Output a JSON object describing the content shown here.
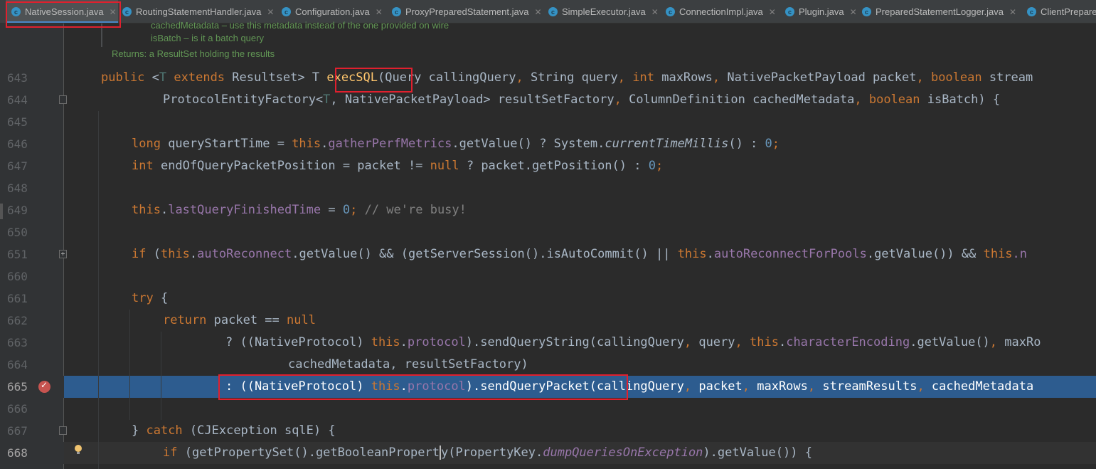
{
  "tabs": [
    {
      "label": "NativeSession.java",
      "active": true
    },
    {
      "label": "RoutingStatementHandler.java"
    },
    {
      "label": "Configuration.java"
    },
    {
      "label": "ProxyPreparedStatement.java"
    },
    {
      "label": "SimpleExecutor.java"
    },
    {
      "label": "ConnectionImpl.java"
    },
    {
      "label": "Plugin.java"
    },
    {
      "label": "PreparedStatementLogger.java"
    },
    {
      "label": "ClientPrepare"
    }
  ],
  "doc_comment": {
    "line1": "cachedMetadata – use this metadata instead of the one provided on wire",
    "line2": "isBatch – is it a batch query",
    "returns": "Returns: a ResultSet holding the results"
  },
  "line_numbers": [
    "643",
    "644",
    "645",
    "646",
    "647",
    "648",
    "649",
    "650",
    "651",
    "660",
    "661",
    "662",
    "663",
    "664",
    "665",
    "666",
    "667",
    "668"
  ],
  "code": {
    "l643": {
      "kw_public": "public",
      "lt": " <",
      "tparam": "T",
      "kw_extends": " extends",
      "rs": " Resultset> T ",
      "method": "execSQL",
      "args1": "(Query callingQuery",
      "c1": ",",
      "args2": " String query",
      "c2": ",",
      "kw_int": " int",
      "args3": " maxRows",
      "c3": ",",
      "args4": " NativePacketPayload packet",
      "c4": ",",
      "kw_bool": " boolean",
      "args5": " stream"
    },
    "l644": {
      "a": "ProtocolEntityFactory<",
      "tp": "T",
      "b": ", NativePacketPayload> resultSetFactory",
      "c1": ",",
      "d": " ColumnDefinition cachedMetadata",
      "c2": ",",
      "kw": " boolean",
      "e": " isBatch) {"
    },
    "l646": {
      "kw": "long",
      "a": " queryStartTime = ",
      "this": "this",
      "dot": ".",
      "fld": "gatherPerfMetrics",
      "b": ".getValue() ? System.",
      "it": "currentTimeMillis",
      "c": "() : ",
      "num": "0",
      "semi": ";"
    },
    "l647": {
      "kw": "int",
      "a": " endOfQueryPacketPosition = packet != ",
      "null": "null",
      "b": " ? packet.getPosition() : ",
      "num": "0",
      "semi": ";"
    },
    "l649": {
      "this": "this",
      "dot": ".",
      "fld": "lastQueryFinishedTime",
      "a": " = ",
      "num": "0",
      "semi": ";",
      "cmt": " // we're busy!"
    },
    "l651": {
      "kw": "if",
      "a": " (",
      "this1": "this",
      "dot1": ".",
      "fld1": "autoReconnect",
      "b": ".getValue() && (getServerSession().isAutoCommit() || ",
      "this2": "this",
      "dot2": ".",
      "fld2": "autoReconnectForPools",
      "c": ".getValue()) && ",
      "this3": "this",
      "d": ".n"
    },
    "l661": {
      "kw": "try",
      "a": " {"
    },
    "l662": {
      "kw": "return",
      "a": " packet == ",
      "null": "null"
    },
    "l663": {
      "a": "? ((NativeProtocol) ",
      "this1": "this",
      "dot1": ".",
      "fld1": "protocol",
      "b": ").sendQueryString(callingQuery",
      "c1": ",",
      "c": " query",
      "c2": ",",
      "this2": " this",
      "dot2": ".",
      "fld2": "characterEncoding",
      "d": ".getValue()",
      "c3": ",",
      "e": " maxRo"
    },
    "l664": {
      "a": "cachedMetadata, resultSetFactory)"
    },
    "l665": {
      "a": ": ((NativeProtocol) ",
      "this": "this",
      "dot": ".",
      "fld": "protocol",
      "b": ").sendQueryPacket(callingQuery",
      "c1": ",",
      "c": " packet",
      "c2": ",",
      "d": " maxRows",
      "c3": ",",
      "e": " streamResults",
      "c4": ",",
      "f": " cachedMetadata"
    },
    "l667": {
      "a": "} ",
      "kw": "catch",
      "b": " (CJException sqlE) {"
    },
    "l668": {
      "kw": "if",
      "a": " (getPropertySet().getBooleanPropert",
      "b": "y(PropertyKey.",
      "it": "dumpQueriesOnException",
      "c": ").getValue()) {"
    }
  }
}
